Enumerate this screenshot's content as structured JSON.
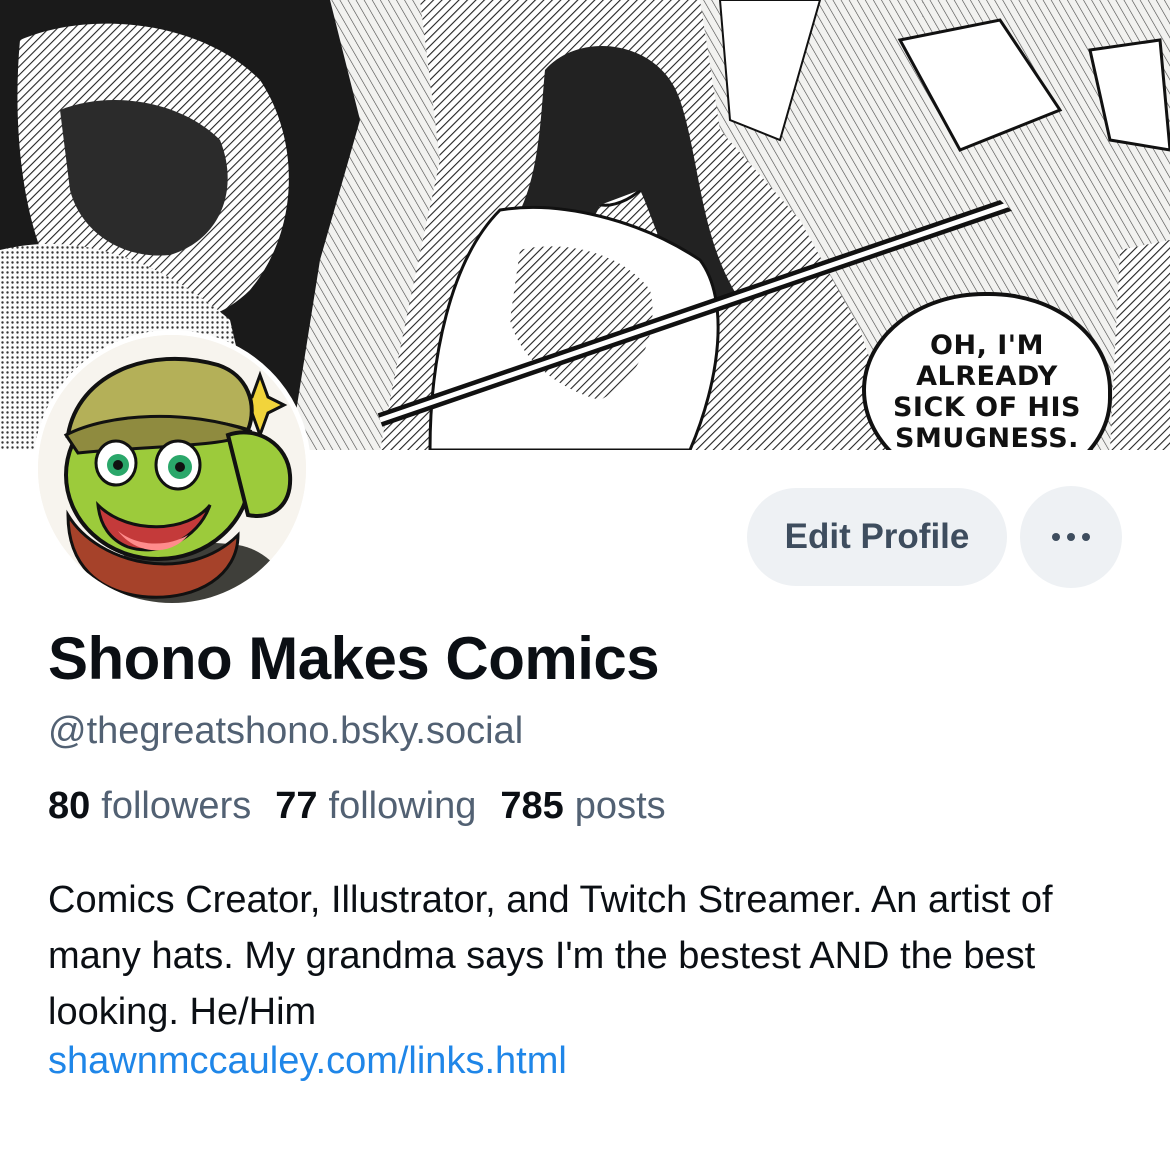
{
  "banner": {
    "speech_bubble": "OH, I'M\nALREADY\nSICK OF HIS\nSMUGNESS."
  },
  "actions": {
    "edit_profile_label": "Edit Profile",
    "more_icon": "ellipsis-icon"
  },
  "profile": {
    "display_name": "Shono Makes Comics",
    "handle": "@thegreatshono.bsky.social",
    "stats": {
      "followers_count": "80",
      "followers_label": "followers",
      "following_count": "77",
      "following_label": "following",
      "posts_count": "785",
      "posts_label": "posts"
    },
    "bio": "Comics Creator, Illustrator, and Twitch Streamer. An artist of many hats. My grandma says I'm the bestest AND the best looking. He/Him",
    "link": "shawnmccauley.com/links.html"
  },
  "colors": {
    "link": "#1f86e8",
    "secondary_text": "#526173",
    "button_bg": "#eef1f4",
    "primary_text": "#0b0f14"
  }
}
